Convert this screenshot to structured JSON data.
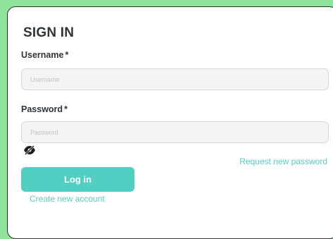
{
  "page": {
    "title": "SIGN IN"
  },
  "form": {
    "username": {
      "label": "Username",
      "required_mark": "*",
      "placeholder": "Username",
      "value": ""
    },
    "password": {
      "label": "Password",
      "required_mark": "*",
      "placeholder": "Password",
      "value": ""
    },
    "toggle_visibility_icon": "eye-slash-icon",
    "request_password_label": "Request new password",
    "login_label": "Log in",
    "create_account_label": "Create new account"
  },
  "colors": {
    "background": "#8fe39a",
    "accent": "#52cfc3",
    "text": "#2f3438"
  }
}
